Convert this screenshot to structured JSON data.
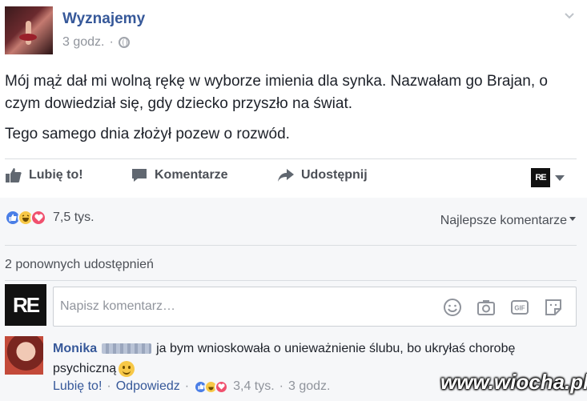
{
  "post": {
    "page_name": "Wyznajemy",
    "time": "3 godz.",
    "dot": "·",
    "paragraphs": [
      "Mój mąż dał mi wolną rękę w wyborze imienia dla synka. Nazwałam go Brajan, o czym dowiedział się, gdy dziecko przyszło na świat.",
      "Tego samego dnia złożył pozew o rozwód."
    ]
  },
  "actions": {
    "like": "Lubię to!",
    "comment": "Komentarze",
    "share": "Udostępnij",
    "page_badge": "RE"
  },
  "reactions": {
    "count": "7,5 tys.",
    "sort": "Najlepsze komentarze"
  },
  "shares": "2 ponownych udostępnień",
  "composer": {
    "avatar_text": "RE",
    "placeholder": "Napisz komentarz…",
    "icons": [
      "emoji-icon",
      "camera-icon",
      "gif-icon",
      "sticker-icon"
    ]
  },
  "comment": {
    "author": "Monika",
    "text": "ja bym wnioskowała o unieważnienie ślubu, bo ukryłaś chorobę psychiczną",
    "like": "Lubię to!",
    "reply": "Odpowiedz",
    "reaction_count": "3,4 tys.",
    "time": "3 godz.",
    "dot": "·"
  },
  "watermark": "www.wiocha.pl",
  "colors": {
    "link_blue": "#365899",
    "like_blue": "#4a7ee6",
    "haha_yellow": "#f7c847",
    "love_red": "#f0506e",
    "reactions_bg": "#f6f7f9"
  }
}
